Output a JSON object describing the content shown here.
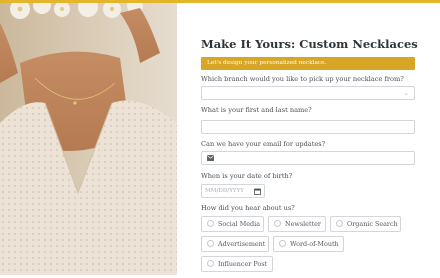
{
  "form": {
    "title": "Make It Yours: Custom Necklaces",
    "banner": "Let's design your personalized necklace.",
    "fields": {
      "branch_label": "Which branch would you like to pick up your necklace from?",
      "branch_value": "",
      "name_label": "What is your first and last name?",
      "name_value": "",
      "email_label": "Can we have your email for updates?",
      "email_value": "",
      "dob_label": "When is your date of birth?",
      "dob_placeholder": "MM/DD/YYYY",
      "source_label": "How did you hear about us?"
    },
    "source_options": [
      "Social Media",
      "Newsletter",
      "Organic Search",
      "Advertisement",
      "Word-of-Mouth",
      "Influencer Post"
    ]
  },
  "colors": {
    "accent_bar": "#e3b52a",
    "banner": "#d8a626",
    "border": "#d3d6da"
  },
  "icons": {
    "dropdown": "chevron-down-icon",
    "email": "envelope-icon",
    "calendar": "calendar-icon"
  }
}
